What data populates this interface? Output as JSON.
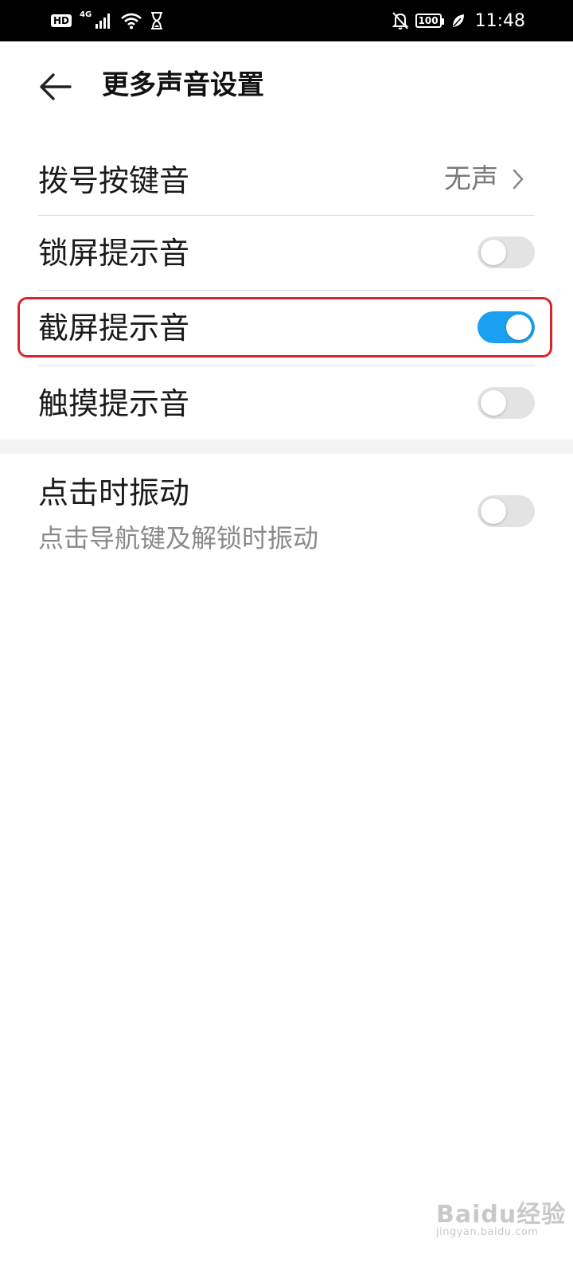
{
  "status_bar": {
    "hd": "HD",
    "network": "4G",
    "battery": "100",
    "time": "11:48"
  },
  "header": {
    "title": "更多声音设置"
  },
  "settings": {
    "dial_tone": {
      "label": "拨号按键音",
      "value": "无声"
    },
    "lock_sound": {
      "label": "锁屏提示音",
      "enabled": false
    },
    "screenshot_sound": {
      "label": "截屏提示音",
      "enabled": true
    },
    "touch_sound": {
      "label": "触摸提示音",
      "enabled": false
    },
    "vibrate_on_tap": {
      "label": "点击时振动",
      "summary": "点击导航键及解锁时振动",
      "enabled": false
    }
  },
  "colors": {
    "accent": "#1aa0f0",
    "highlight": "#d9252e"
  },
  "watermark": {
    "main": "Baidu经验",
    "sub": "jingyan.baidu.com"
  }
}
